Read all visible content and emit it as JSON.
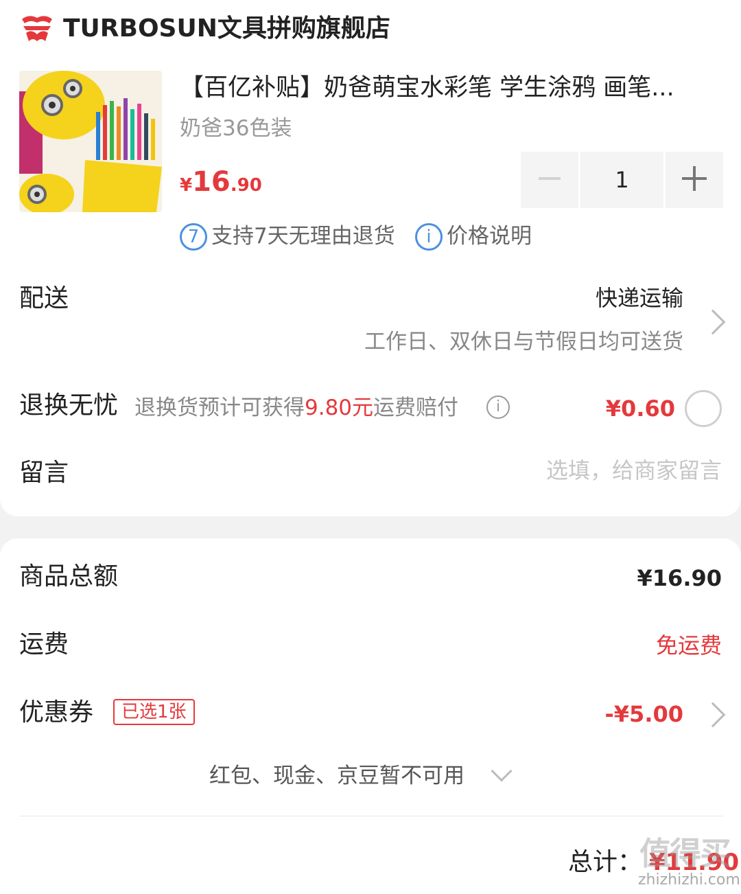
{
  "colors": {
    "accent_red": "#e4393c",
    "info_blue": "#4a90e2",
    "muted": "#888888"
  },
  "store": {
    "logo_icon": "store-logo-icon",
    "name": "TURBOSUN文具拼购旗舰店"
  },
  "product": {
    "title": "【百亿补贴】奶爸萌宝水彩笔 学生涂鸦 画笔...",
    "variant": "奶爸36色装",
    "price_symbol": "¥",
    "price_int": "16",
    "price_dec": ".90",
    "quantity": "1",
    "minus_icon": "minus-icon",
    "plus_icon": "plus-icon"
  },
  "services": [
    {
      "icon_text": "7",
      "label": "支持7天无理由退货"
    },
    {
      "icon_text": "i",
      "label": "价格说明"
    }
  ],
  "delivery": {
    "label": "配送",
    "value": "快递运输",
    "sub": "工作日、双休日与节假日均可送货"
  },
  "return_insurance": {
    "label": "退换无忧",
    "desc_prefix": "退换货预计可获得",
    "desc_amount": "9.80元",
    "desc_suffix": "运费赔付",
    "info_icon": "i",
    "price": "¥0.60"
  },
  "message": {
    "label": "留言",
    "placeholder": "选填，给商家留言",
    "value": ""
  },
  "summary": {
    "goods_label": "商品总额",
    "goods_value": "¥16.90",
    "shipping_label": "运费",
    "shipping_value": "免运费",
    "coupon_label": "优惠券",
    "coupon_tag": "已选1张",
    "coupon_value": "-¥5.00",
    "more_text": "红包、现金、京豆暂不可用"
  },
  "total": {
    "label": "总计：",
    "value": "¥11.90"
  },
  "watermark": {
    "text": "值得买",
    "url": "zhizhizhi.com"
  }
}
